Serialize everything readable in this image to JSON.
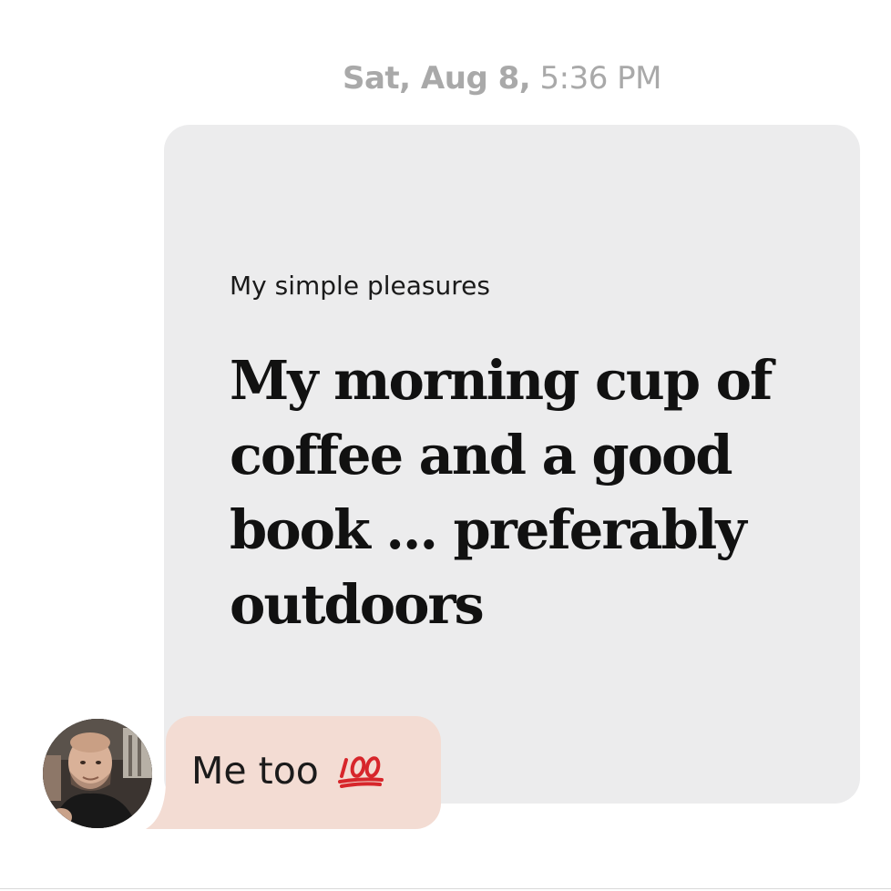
{
  "message_header": {
    "date": "Sat, Aug 8,",
    "time": "5:36 PM"
  },
  "prompt_card": {
    "prompt": "My simple pleasures",
    "answer": "My morning cup of coffee and a good book ... preferably outdoors"
  },
  "reply": {
    "text": "Me too",
    "emoji_icon": "hundred-points-icon"
  },
  "colors": {
    "card_background": "#ececed",
    "reply_bubble": "#f3dcd3",
    "timestamp": "#a9a9a9",
    "emoji_red": "#d7262b"
  }
}
